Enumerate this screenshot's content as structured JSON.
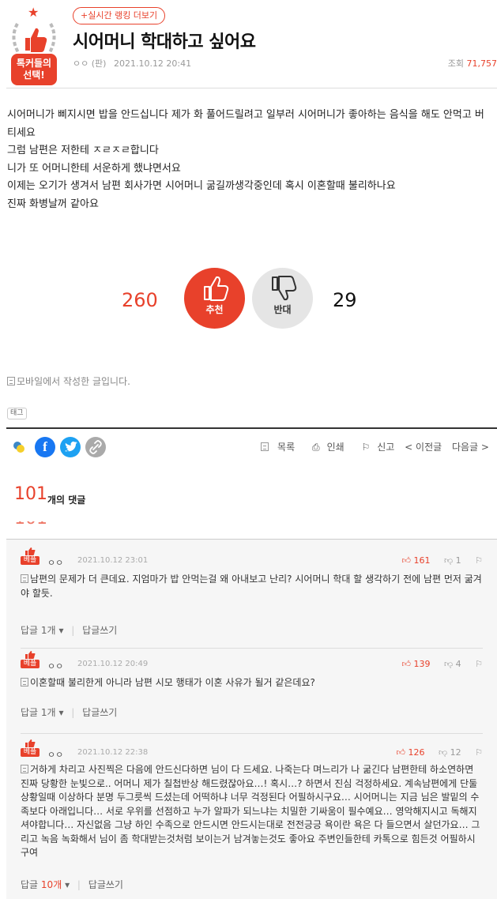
{
  "badge": {
    "label_line1": "톡커들의",
    "label_line2": "선택!"
  },
  "header": {
    "rank_link": "+실시간 랭킹 더보기",
    "title": "시어머니 학대하고 싶어요",
    "author": "ㅇㅇ (판)",
    "date": "2021.10.12 20:41",
    "views_label": "조회",
    "views": "71,757"
  },
  "post": {
    "lines": [
      "시어머니가 삐지시면 밥을 안드십니다 제가 화 풀어드릴려고 일부러 시어머니가 좋아하는 음식을 해도 안먹고 버티세요",
      "그럼 남편은 저한테 ㅈㄹㅈㄹ합니다",
      "니가 또 어머니한테 서운하게 했냐면서요",
      "이제는 오기가 생겨서 남편 회사가면 시어머니 굶길까생각중인데 혹시 이혼할때 불리하나요",
      "진짜 화병날꺼 같아요"
    ]
  },
  "votes": {
    "up_count": "260",
    "up_label": "추천",
    "down_label": "반대",
    "down_count": "29"
  },
  "mobile_note": "모바일에서 작성한 글입니다.",
  "tag_label": "태그",
  "share": {
    "facebook": "f",
    "twitter": "t"
  },
  "tools": {
    "list": "목록",
    "print": "인쇄",
    "report": "신고",
    "prev": "< 이전글",
    "next": "다음글 >"
  },
  "comments": {
    "count": "101",
    "count_label": "개의 댓글",
    "items": [
      {
        "badge": "베플",
        "author": "ㅇㅇ",
        "date": "2021.10.12 23:01",
        "up": "161",
        "down": "1",
        "text": "남편의 문제가 더 큰데요. 지엄마가 밥 안먹는걸 왜 아내보고 난리? 시어머니 학대 할 생각하기 전에 남편 먼저 굶겨야 할듯.",
        "reply_label": "답글",
        "reply_count": "1개",
        "write_reply": "답글쓰기"
      },
      {
        "badge": "베플",
        "author": "ㅇㅇ",
        "date": "2021.10.12 20:49",
        "up": "139",
        "down": "4",
        "text": "이혼할때 불리한게 아니라 남편 시모 행태가 이혼 사유가 될거 같은데요?",
        "reply_label": "답글",
        "reply_count": "1개",
        "write_reply": "답글쓰기"
      },
      {
        "badge": "베플",
        "author": "ㅇㅇ",
        "date": "2021.10.12 22:38",
        "up": "126",
        "down": "12",
        "text": "거하게 차리고 사진찍은 다음에 안드신다하면 님이 다 드세요. 나죽는다 며느리가 나 굶긴다 남편한테 하소연하면 진짜 당황한 눈빛으로.. 어머니 제가 칠첩반상 해드렸잖아요…! 혹시…? 하면서 진심 걱정하세요. 계속남편에게 단둘상황일때 이상하다 분명 두그릇씩 드셨는데 어떡하냐 너무 걱정된다 어필하시구요… 시어머니는 지금 님은 발밑의 수족보다 아래입니다… 서로 우위를 선점하고 누가 알파가 되느냐는 치밀한 기싸움이 필수예요… 영악해지시고 독해지셔야합니다… 자신없음 그냥 하인 수족으로 안드시면 안드시는대로 전전긍긍 욕이란 욕은 다 들으면서 살던가요… 그리고 녹음 녹화해서 님이 좀 학대받는것처럼 보이는거 남겨놓는것도 좋아요 주변인들한테 카톡으로 힘든것 어필하시구여",
        "reply_label": "답글",
        "reply_count": "10개",
        "write_reply": "답글쓰기"
      }
    ]
  },
  "colors": {
    "accent": "#e8412b",
    "facebook": "#1877f2",
    "twitter": "#1da1f2"
  }
}
